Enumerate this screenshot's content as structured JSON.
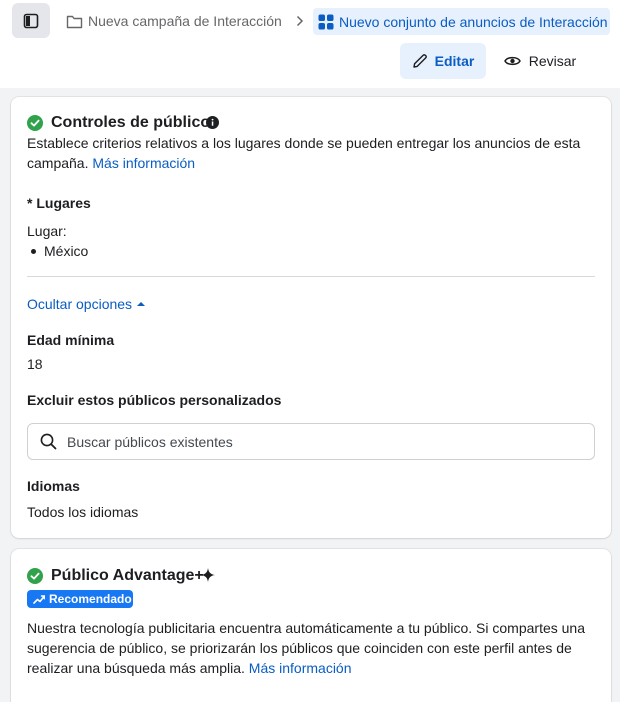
{
  "breadcrumb": {
    "campaign": "Nueva campaña de Interacción",
    "ad_set": "Nuevo conjunto de anuncios de Interacción"
  },
  "actions": {
    "edit_label": "Editar",
    "review_label": "Revisar"
  },
  "audience_controls": {
    "title": "Controles de público",
    "description": "Establece criterios relativos a los lugares donde se pueden entregar los anuncios de esta campaña.",
    "more_info": "Más información",
    "locations_label": "* Lugares",
    "location_prefix": "Lugar:",
    "locations": [
      "México"
    ],
    "hide_options": "Ocultar opciones",
    "min_age_label": "Edad mínima",
    "min_age_value": "18",
    "exclude_label": "Excluir estos públicos personalizados",
    "search_placeholder": "Buscar públicos existentes",
    "languages_label": "Idiomas",
    "languages_value": "Todos los idiomas"
  },
  "advantage": {
    "title": "Público Advantage+",
    "badge": "Recomendado",
    "description": "Nuestra tecnología publicitaria encuentra automáticamente a tu público. Si compartes una sugerencia de público, se priorizarán los públicos que coinciden con este perfil antes de realizar una búsqueda más amplia.",
    "more_info": "Más información"
  },
  "colors": {
    "accent": "#0a5dc2",
    "success": "#31a24c",
    "badge": "#1877f2"
  },
  "icons": {
    "sidebar_toggle": "sidebar-toggle-icon",
    "folder": "folder-icon",
    "chevron_right": "chevron-right-icon",
    "grid": "grid-icon",
    "pencil": "pencil-icon",
    "eye": "eye-icon",
    "check": "check-circle-icon",
    "info": "info-icon",
    "caret_up": "caret-up-icon",
    "search": "search-icon",
    "sparkle": "sparkle-icon",
    "trend": "trend-icon"
  }
}
